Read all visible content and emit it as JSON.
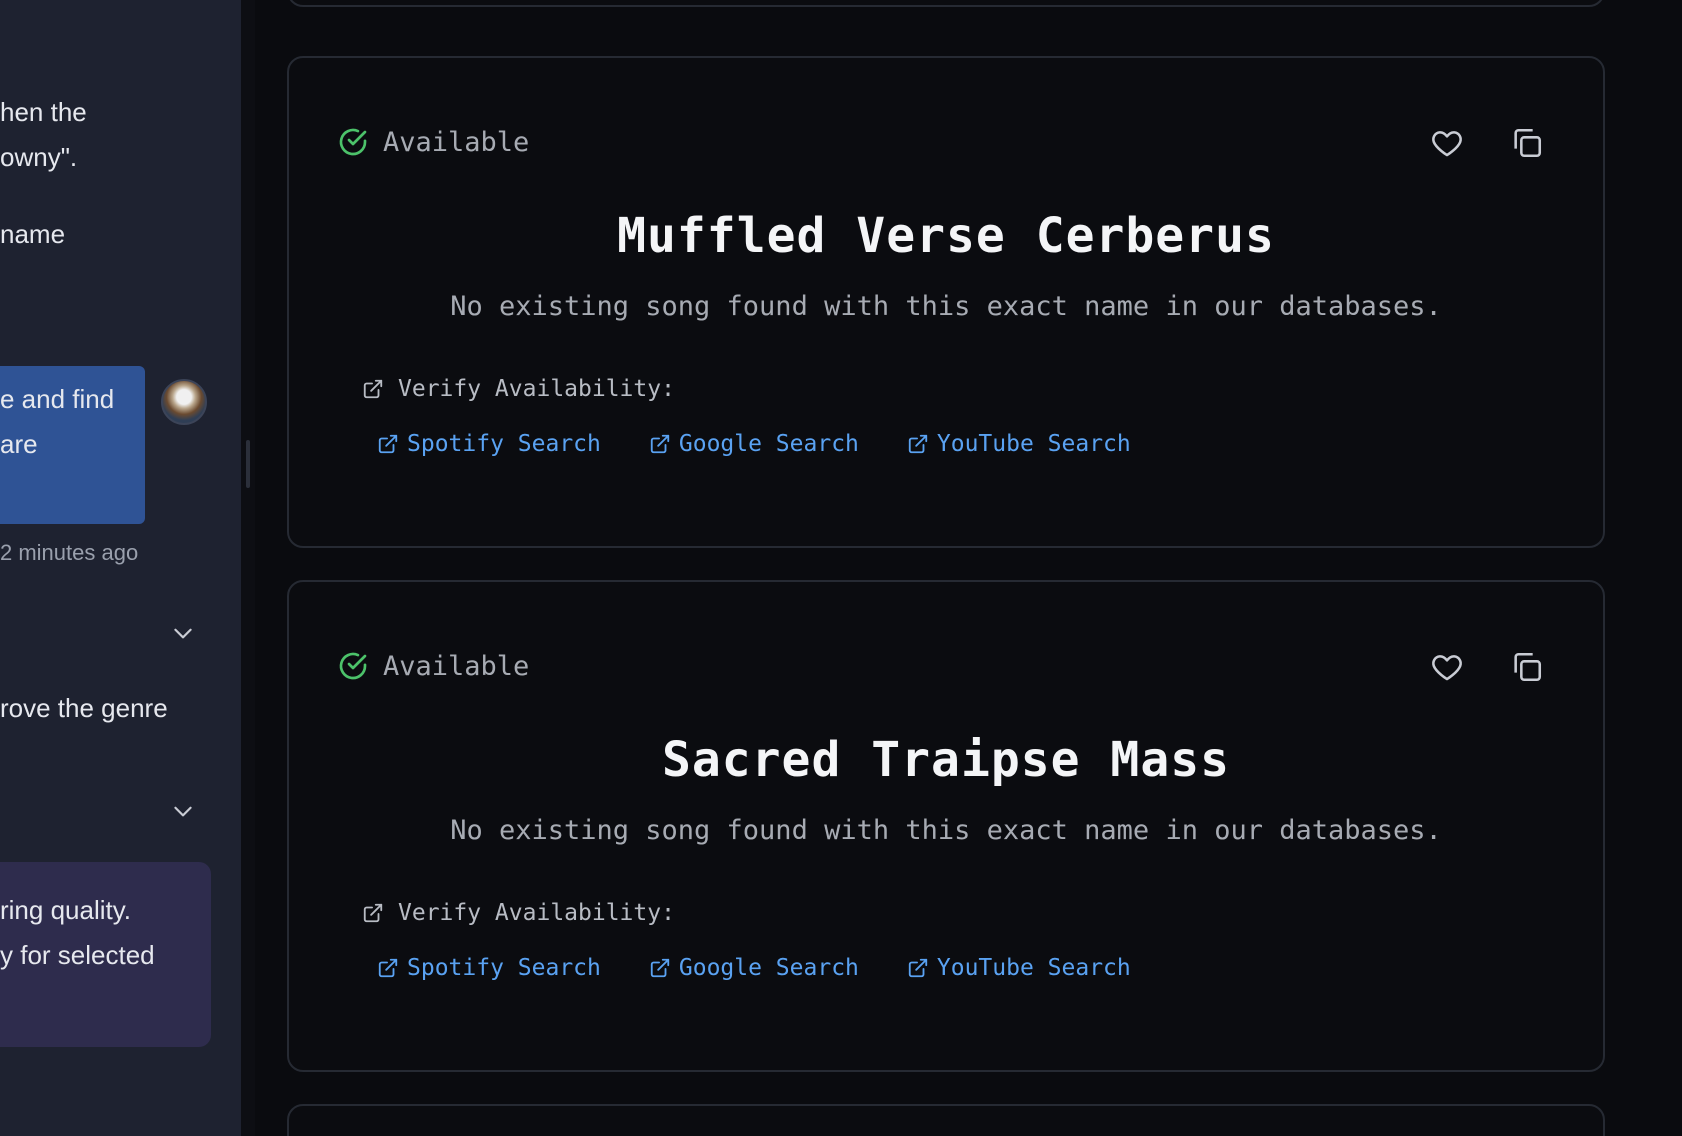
{
  "sidebar": {
    "lines": [
      "hen the",
      "owny\".",
      " name",
      "e and find",
      "are",
      "rove the genre",
      "ring quality.",
      "y for selected"
    ],
    "timestamp": "2 minutes ago",
    "colors": {
      "panel": "#1e2230",
      "user_bubble": "#2f5395",
      "assistant_bubble": "#2e2c4d"
    }
  },
  "results": [
    {
      "status": "Available",
      "title": "Muffled Verse Cerberus",
      "description": "No existing song found with this exact name in our databases.",
      "verify_label": "Verify Availability:",
      "links": [
        "Spotify Search",
        "Google Search",
        "YouTube Search"
      ]
    },
    {
      "status": "Available",
      "title": "Sacred Traipse Mass",
      "description": "No existing song found with this exact name in our databases.",
      "verify_label": "Verify Availability:",
      "links": [
        "Spotify Search",
        "Google Search",
        "YouTube Search"
      ]
    }
  ],
  "icons": {
    "status": "check-circle-icon",
    "favorite": "heart-icon",
    "copy": "copy-icon",
    "external": "external-link-icon",
    "collapse": "chevron-down-icon"
  },
  "colors": {
    "background": "#0a0b0f",
    "available": "#4cc26a",
    "link": "#5aa2f2",
    "title": "#f4f5f7",
    "muted": "#a7abb3"
  }
}
